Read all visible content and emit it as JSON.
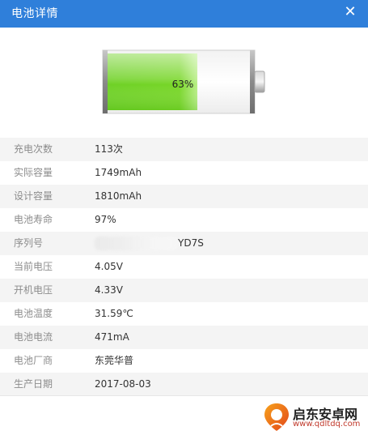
{
  "window": {
    "title": "电池详情",
    "close_label": "✕"
  },
  "battery": {
    "level_percent": 63,
    "level_label": "63%",
    "fill_colors": [
      "#6ad321",
      "#9eea57"
    ]
  },
  "details": [
    {
      "label": "充电次数",
      "value": "113次"
    },
    {
      "label": "实际容量",
      "value": "1749mAh"
    },
    {
      "label": "设计容量",
      "value": "1810mAh"
    },
    {
      "label": "电池寿命",
      "value": "97%"
    },
    {
      "label": "序列号",
      "value": "YD7S"
    },
    {
      "label": "当前电压",
      "value": "4.05V"
    },
    {
      "label": "开机电压",
      "value": "4.33V"
    },
    {
      "label": "电池温度",
      "value": "31.59℃"
    },
    {
      "label": "电池电流",
      "value": "471mA"
    },
    {
      "label": "电池厂商",
      "value": "东莞华普"
    },
    {
      "label": "生产日期",
      "value": "2017-08-03"
    }
  ],
  "watermark": {
    "brand": "启东安卓网",
    "url": "www.qdltdq.com",
    "icon": "orange-pin-icon"
  },
  "colors": {
    "titlebar": "#2f7fda",
    "label_text": "#8c8c8c",
    "value_text": "#333333",
    "row_alt": "#f4f4f4"
  }
}
